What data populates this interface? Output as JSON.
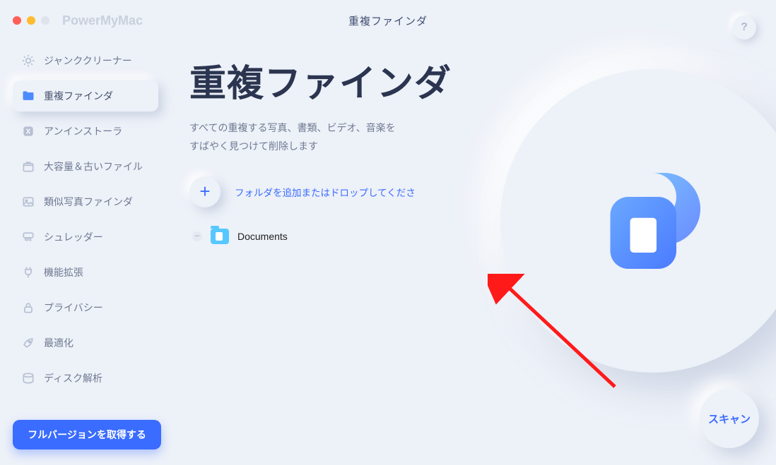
{
  "window": {
    "app_name": "PowerMyMac",
    "title": "重複ファインダ",
    "help_label": "?"
  },
  "sidebar": {
    "items": [
      {
        "id": "junk",
        "label": "ジャンククリーナー",
        "icon": "sparkle-icon"
      },
      {
        "id": "duplicate",
        "label": "重複ファインダ",
        "icon": "folder-icon",
        "active": true
      },
      {
        "id": "uninstall",
        "label": "アンインストーラ",
        "icon": "app-icon"
      },
      {
        "id": "large-old",
        "label": "大容量＆古いファイル",
        "icon": "box-icon"
      },
      {
        "id": "similar",
        "label": "類似写真ファインダ",
        "icon": "image-icon"
      },
      {
        "id": "shredder",
        "label": "シュレッダー",
        "icon": "shredder-icon"
      },
      {
        "id": "extensions",
        "label": "機能拡張",
        "icon": "plug-icon"
      },
      {
        "id": "privacy",
        "label": "プライバシー",
        "icon": "lock-icon"
      },
      {
        "id": "optimize",
        "label": "最適化",
        "icon": "rocket-icon"
      },
      {
        "id": "disk",
        "label": "ディスク解析",
        "icon": "disk-icon"
      }
    ],
    "upgrade_label": "フルバージョンを取得する"
  },
  "main": {
    "hero_title": "重複ファインダ",
    "hero_sub_line1": "すべての重複する写真、書類、ビデオ、音楽を",
    "hero_sub_line2": "すばやく見つけて削除します",
    "add_label": "フォルダを追加またはドロップしてくださ",
    "folders": [
      {
        "name": "Documents"
      }
    ],
    "scan_label": "スキャン"
  }
}
